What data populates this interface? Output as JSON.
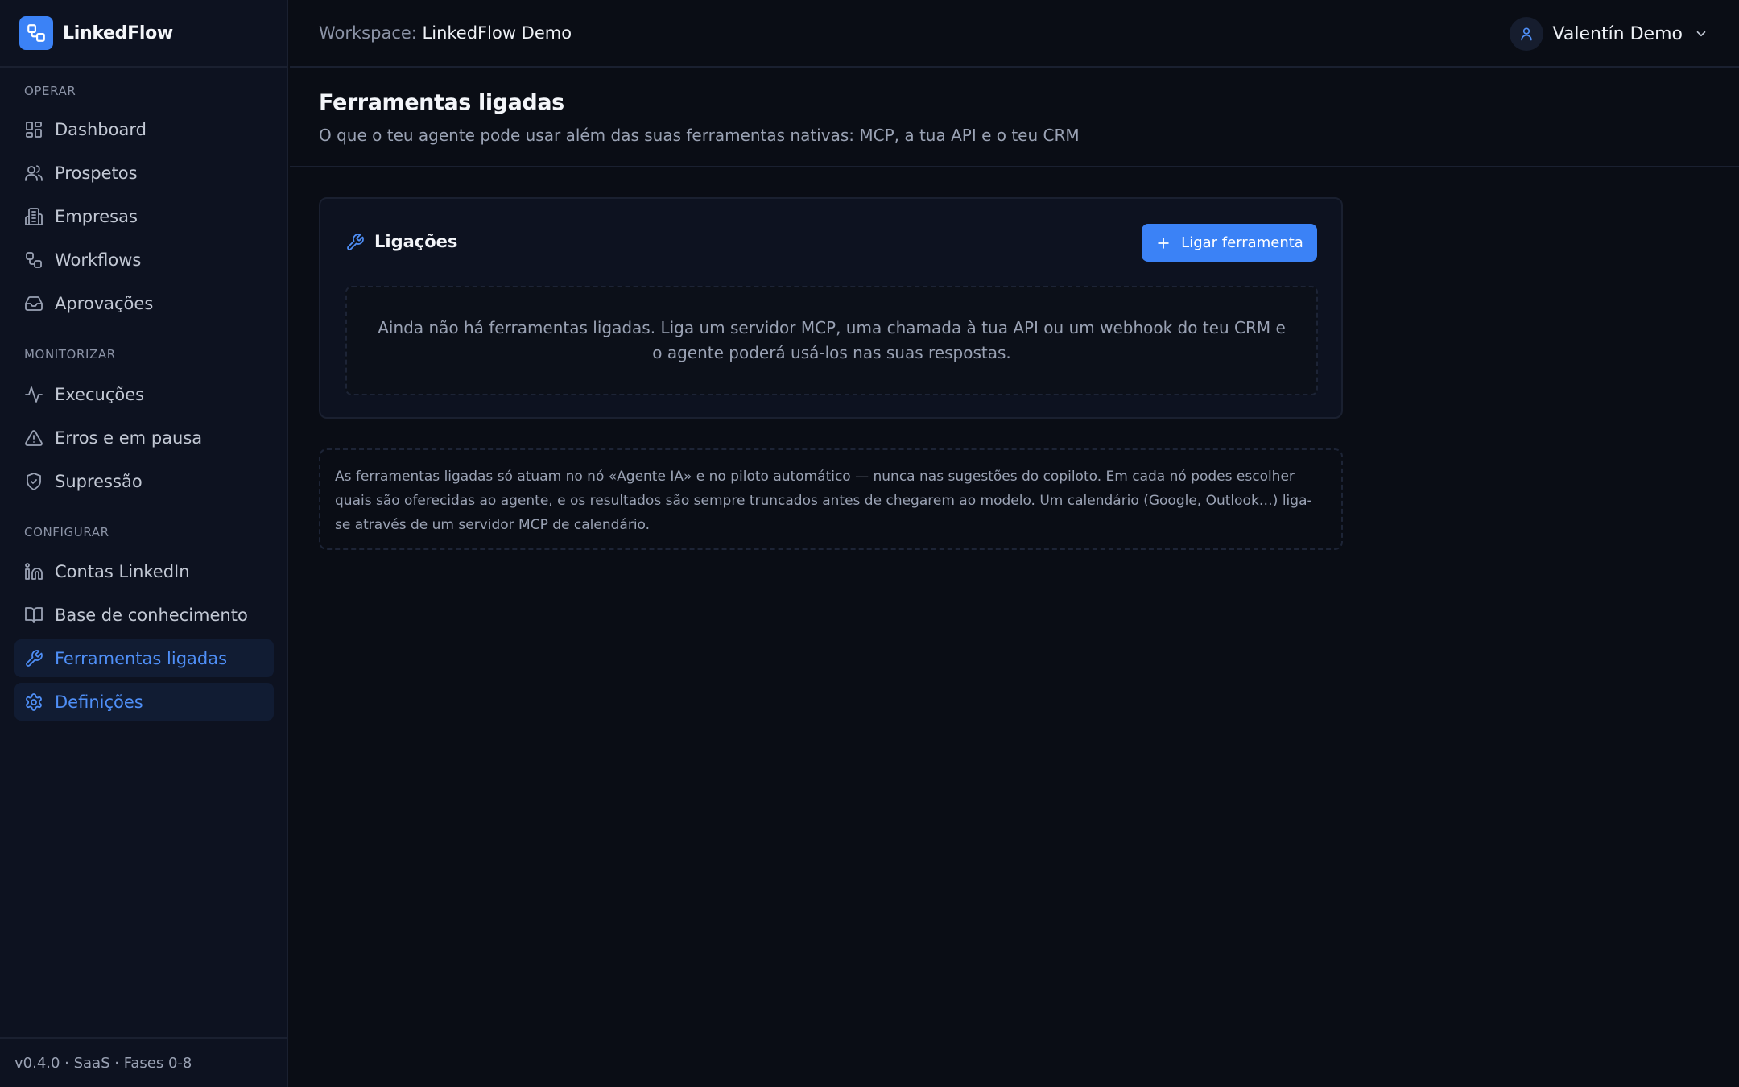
{
  "brand": {
    "name": "LinkedFlow",
    "accent": "#3b82f6"
  },
  "topbar": {
    "workspace_label": "Workspace:",
    "workspace_name": "LinkedFlow Demo",
    "user_name": "Valentín Demo"
  },
  "sidebar": {
    "sections": {
      "operar": "OPERAR",
      "monitorizar": "MONITORIZAR",
      "configurar": "CONFIGURAR"
    },
    "items": [
      {
        "label": "Dashboard",
        "icon": "dashboard-icon"
      },
      {
        "label": "Prospetos",
        "icon": "users-icon"
      },
      {
        "label": "Empresas",
        "icon": "building-icon"
      },
      {
        "label": "Workflows",
        "icon": "workflow-icon"
      },
      {
        "label": "Aprovações",
        "icon": "inbox-icon"
      },
      {
        "label": "Execuções",
        "icon": "activity-icon"
      },
      {
        "label": "Erros e em pausa",
        "icon": "alert-triangle-icon"
      },
      {
        "label": "Supressão",
        "icon": "shield-icon"
      },
      {
        "label": "Contas LinkedIn",
        "icon": "linkedin-icon"
      },
      {
        "label": "Base de conhecimento",
        "icon": "book-icon"
      },
      {
        "label": "Ferramentas ligadas",
        "icon": "wrench-icon",
        "active": true
      },
      {
        "label": "Definições",
        "icon": "gear-icon",
        "active": true
      }
    ],
    "footer": "v0.4.0 · SaaS · Fases 0-8"
  },
  "page": {
    "title": "Ferramentas ligadas",
    "subtitle": "O que o teu agente pode usar além das suas ferramentas nativas: MCP, a tua API e o teu CRM"
  },
  "card": {
    "title": "Ligações",
    "button_label": "Ligar ferramenta",
    "empty_text": "Ainda não há ferramentas ligadas. Liga um servidor MCP, uma chamada à tua API ou um webhook do teu CRM e o agente poderá usá-los nas suas respostas."
  },
  "note": {
    "text": "As ferramentas ligadas só atuam no nó «Agente IA» e no piloto automático — nunca nas sugestões do copiloto. Em cada nó podes escolher quais são oferecidas ao agente, e os resultados são sempre truncados antes de chegarem ao modelo. Um calendário (Google, Outlook…) liga-se através de um servidor MCP de calendário."
  }
}
